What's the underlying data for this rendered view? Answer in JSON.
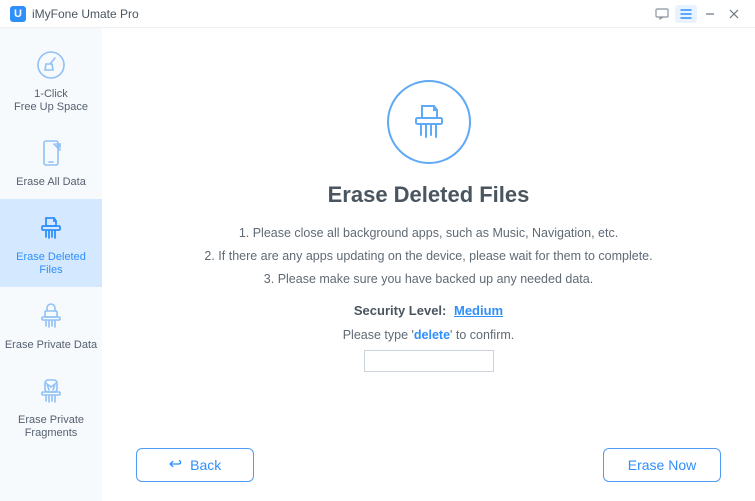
{
  "titlebar": {
    "app_logo_letter": "U",
    "title": "iMyFone Umate Pro"
  },
  "sidebar": {
    "items": [
      {
        "label": "1-Click\nFree Up Space"
      },
      {
        "label": "Erase All Data"
      },
      {
        "label": "Erase Deleted Files"
      },
      {
        "label": "Erase Private Data"
      },
      {
        "label": "Erase Private\nFragments"
      }
    ],
    "active_index": 2
  },
  "main": {
    "page_title": "Erase Deleted Files",
    "instructions": [
      "1. Please close all background apps, such as Music, Navigation, etc.",
      "2. If there are any apps updating on the device, please wait for them to complete.",
      "3. Please make sure you have backed up any needed data."
    ],
    "security_label": "Security Level:",
    "security_value": "Medium",
    "confirm_prefix": "Please type '",
    "confirm_keyword": "delete",
    "confirm_suffix": "' to confirm.",
    "confirm_input_value": ""
  },
  "footer": {
    "back_label": "Back",
    "erase_label": "Erase Now"
  }
}
